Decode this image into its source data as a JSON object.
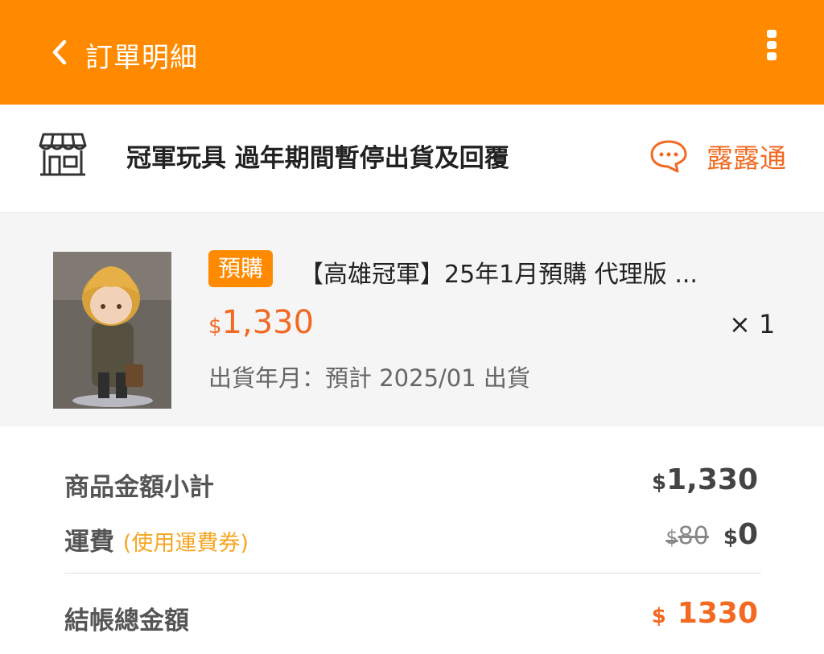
{
  "header": {
    "title": "訂單明細",
    "back_icon": "chevron-left-icon",
    "more_icon": "more-vertical-icon"
  },
  "store": {
    "name": "冠軍玩具 過年期間暫停出貨及回覆",
    "icon": "store-icon",
    "chat_label": "露露通",
    "chat_icon": "chat-bubble-icon"
  },
  "product": {
    "badge": "預購",
    "title": "【高雄冠軍】25年1月預購 代理版 ...",
    "currency": "$",
    "price": "1,330",
    "quantity": "× 1",
    "shipping_date": "出貨年月：預計 2025/01 出貨"
  },
  "summary": {
    "subtotal_label": "商品金額小計",
    "subtotal_currency": "$",
    "subtotal_value": "1,330",
    "shipping_label": "運費",
    "shipping_coupon": "(使用運費券)",
    "shipping_original_currency": "$",
    "shipping_original": "80",
    "shipping_currency": "$",
    "shipping_value": "0",
    "total_label": "結帳總金額",
    "total_currency": "$",
    "total_value": "1330"
  },
  "colors": {
    "header_bg": "#ff8a00",
    "accent": "#f26a21",
    "coupon": "#f5a623"
  }
}
